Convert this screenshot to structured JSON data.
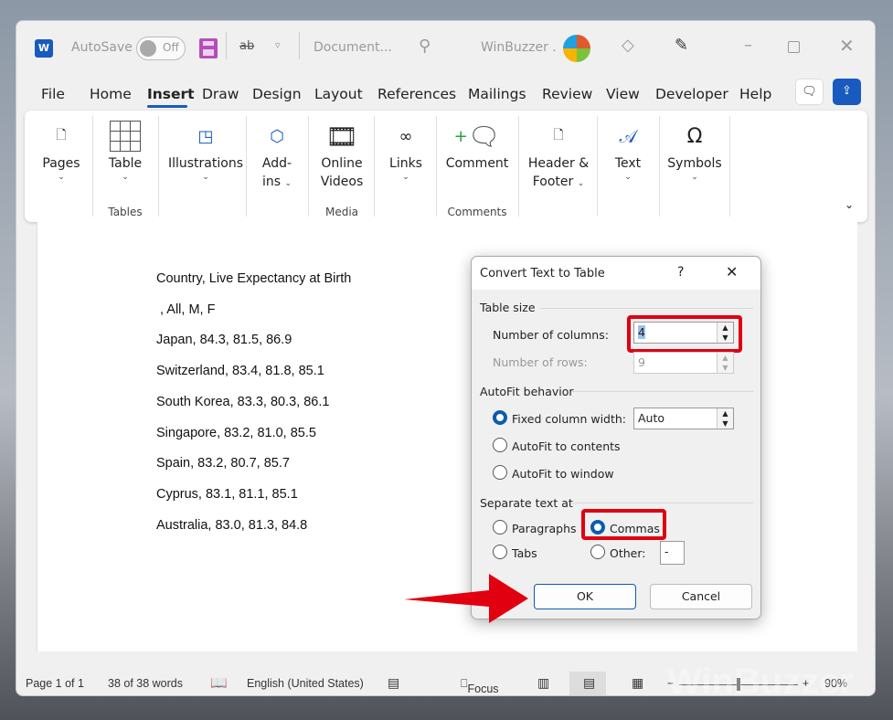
{
  "titlebar": {
    "autosave": "AutoSave",
    "toggle": "Off",
    "doc": "Document...",
    "user": "WinBuzzer ."
  },
  "tabs": [
    "File",
    "Home",
    "Insert",
    "Draw",
    "Design",
    "Layout",
    "References",
    "Mailings",
    "Review",
    "View",
    "Developer",
    "Help"
  ],
  "ribbon": {
    "pages": "Pages",
    "table": "Table",
    "tables_group": "Tables",
    "illustrations": "Illustrations",
    "addins1": "Add-",
    "addins2": "ins",
    "online": "Online",
    "videos": "Videos",
    "media_group": "Media",
    "links": "Links",
    "comment": "Comment",
    "comments_group": "Comments",
    "header1": "Header &",
    "header2": "Footer",
    "text": "Text",
    "symbols": "Symbols"
  },
  "document": {
    "lines": [
      "Country, Live Expectancy at Birth",
      " , All, M, F",
      "Japan, 84.3, 81.5, 86.9",
      "Switzerland, 83.4, 81.8, 85.1",
      "South Korea, 83.3, 80.3, 86.1",
      "Singapore, 83.2, 81.0, 85.5",
      "Spain, 83.2, 80.7, 85.7",
      "Cyprus, 83.1, 81.1, 85.1",
      "Australia, 83.0, 81.3, 84.8"
    ]
  },
  "dialog": {
    "title": "Convert Text to Table",
    "help": "?",
    "table_size": "Table size",
    "num_cols_label": "Number of columns:",
    "num_cols": "4",
    "num_rows_label": "Number of rows:",
    "num_rows": "9",
    "autofit": "AutoFit behavior",
    "fixed": "Fixed column width:",
    "fixed_val": "Auto",
    "contents": "AutoFit to contents",
    "window": "AutoFit to window",
    "separate": "Separate text at",
    "paragraphs": "Paragraphs",
    "commas": "Commas",
    "tabs": "Tabs",
    "other": "Other:",
    "other_val": "-",
    "ok": "OK",
    "cancel": "Cancel"
  },
  "status": {
    "page": "Page 1 of 1",
    "words": "38 of 38 words",
    "lang": "English (United States)",
    "focus": "Focus",
    "zoom": "90%"
  },
  "colors": {
    "accent": "#185abd",
    "highlight": "#e00010"
  }
}
